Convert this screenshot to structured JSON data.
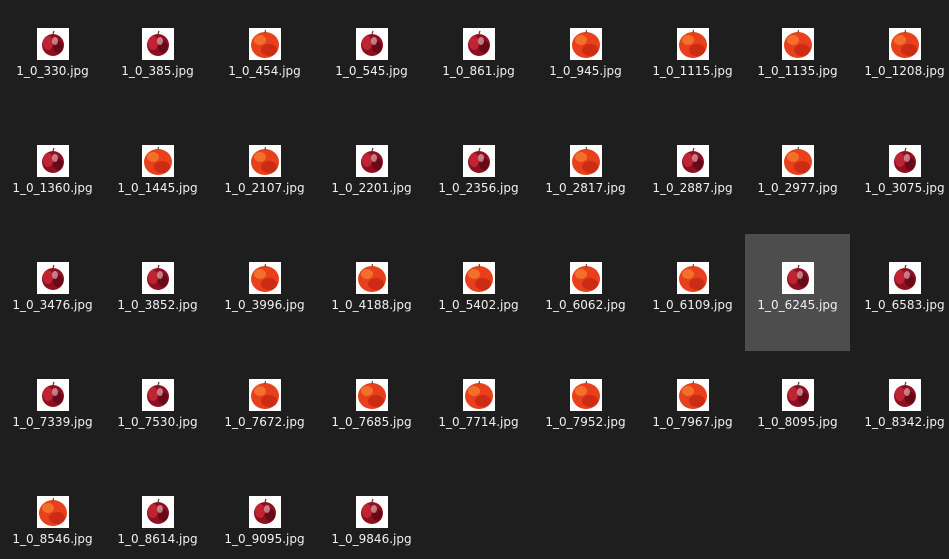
{
  "view": {
    "selected_file": "1_0_6245.jpg",
    "colors": {
      "background": "#1e1e1e",
      "selection": "#4d4d4d",
      "label_text": "#f0f0f0"
    }
  },
  "files": [
    {
      "name": "1_0_330.jpg",
      "thumb": "dark-red-apple"
    },
    {
      "name": "1_0_385.jpg",
      "thumb": "dark-red-apple"
    },
    {
      "name": "1_0_454.jpg",
      "thumb": "red-orange-apple"
    },
    {
      "name": "1_0_545.jpg",
      "thumb": "dark-red-apple"
    },
    {
      "name": "1_0_861.jpg",
      "thumb": "dark-red-apple"
    },
    {
      "name": "1_0_945.jpg",
      "thumb": "red-orange-apple"
    },
    {
      "name": "1_0_1115.jpg",
      "thumb": "red-orange-apple"
    },
    {
      "name": "1_0_1135.jpg",
      "thumb": "red-orange-apple"
    },
    {
      "name": "1_0_1208.jpg",
      "thumb": "red-orange-apple"
    },
    {
      "name": "1_0_1360.jpg",
      "thumb": "dark-red-apple"
    },
    {
      "name": "1_0_1445.jpg",
      "thumb": "red-orange-apple"
    },
    {
      "name": "1_0_2107.jpg",
      "thumb": "red-orange-apple"
    },
    {
      "name": "1_0_2201.jpg",
      "thumb": "dark-red-apple"
    },
    {
      "name": "1_0_2356.jpg",
      "thumb": "dark-red-apple"
    },
    {
      "name": "1_0_2817.jpg",
      "thumb": "red-orange-apple"
    },
    {
      "name": "1_0_2887.jpg",
      "thumb": "dark-red-apple"
    },
    {
      "name": "1_0_2977.jpg",
      "thumb": "red-orange-apple"
    },
    {
      "name": "1_0_3075.jpg",
      "thumb": "dark-red-apple"
    },
    {
      "name": "1_0_3476.jpg",
      "thumb": "dark-red-apple"
    },
    {
      "name": "1_0_3852.jpg",
      "thumb": "dark-red-apple"
    },
    {
      "name": "1_0_3996.jpg",
      "thumb": "red-orange-apple"
    },
    {
      "name": "1_0_4188.jpg",
      "thumb": "red-orange-apple"
    },
    {
      "name": "1_0_5402.jpg",
      "thumb": "red-orange-apple"
    },
    {
      "name": "1_0_6062.jpg",
      "thumb": "red-orange-apple"
    },
    {
      "name": "1_0_6109.jpg",
      "thumb": "red-orange-apple"
    },
    {
      "name": "1_0_6245.jpg",
      "thumb": "dark-red-apple"
    },
    {
      "name": "1_0_6583.jpg",
      "thumb": "dark-red-apple"
    },
    {
      "name": "1_0_7339.jpg",
      "thumb": "dark-red-apple"
    },
    {
      "name": "1_0_7530.jpg",
      "thumb": "dark-red-apple"
    },
    {
      "name": "1_0_7672.jpg",
      "thumb": "red-orange-apple"
    },
    {
      "name": "1_0_7685.jpg",
      "thumb": "red-orange-apple"
    },
    {
      "name": "1_0_7714.jpg",
      "thumb": "red-orange-apple"
    },
    {
      "name": "1_0_7952.jpg",
      "thumb": "red-orange-apple"
    },
    {
      "name": "1_0_7967.jpg",
      "thumb": "red-orange-apple"
    },
    {
      "name": "1_0_8095.jpg",
      "thumb": "dark-red-apple"
    },
    {
      "name": "1_0_8342.jpg",
      "thumb": "dark-red-apple"
    },
    {
      "name": "1_0_8546.jpg",
      "thumb": "red-orange-apple"
    },
    {
      "name": "1_0_8614.jpg",
      "thumb": "dark-red-apple"
    },
    {
      "name": "1_0_9095.jpg",
      "thumb": "dark-red-apple"
    },
    {
      "name": "1_0_9846.jpg",
      "thumb": "dark-red-apple"
    }
  ]
}
